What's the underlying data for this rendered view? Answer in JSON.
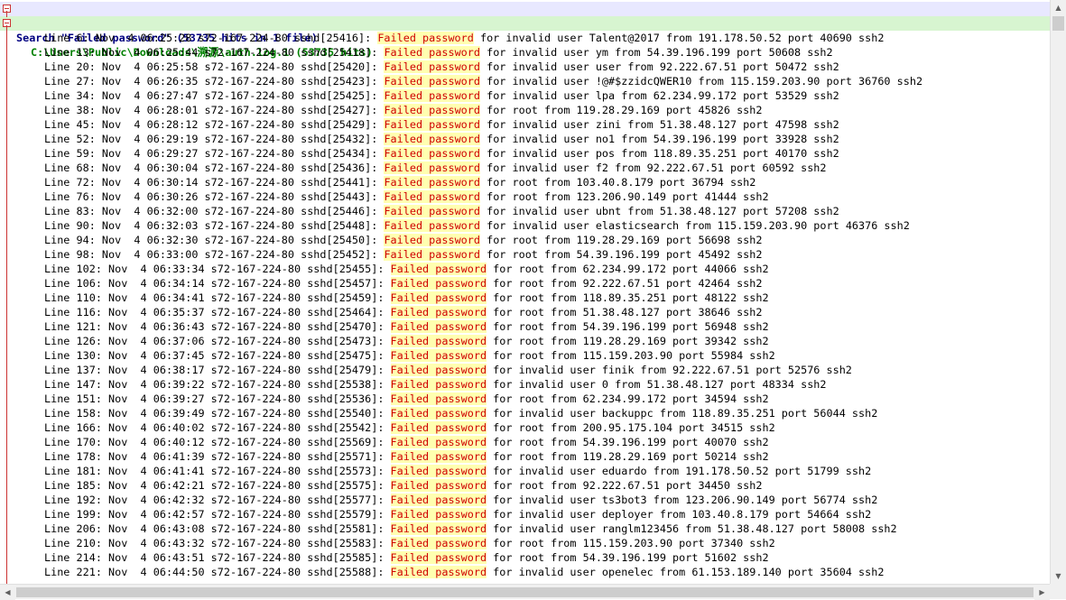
{
  "search": {
    "header": "Search \"Failed password\" (53735 hits in 1 file)",
    "file": "C:\\Users\\Public\\Downloads\\溯源\\auth.log.1 (53735 hits)"
  },
  "keyword": "Failed password",
  "rows": [
    {
      "prefix": "Line 6: Nov  4 06:25:28 s72-167-224-80 sshd[25416]: ",
      "suffix": " for invalid user Talent@2017 from 191.178.50.52 port 40690 ssh2"
    },
    {
      "prefix": "Line 13: Nov  4 06:25:44 s72-167-224-80 sshd[25418]: ",
      "suffix": " for invalid user ym from 54.39.196.199 port 50608 ssh2"
    },
    {
      "prefix": "Line 20: Nov  4 06:25:58 s72-167-224-80 sshd[25420]: ",
      "suffix": " for invalid user user from 92.222.67.51 port 50472 ssh2"
    },
    {
      "prefix": "Line 27: Nov  4 06:26:35 s72-167-224-80 sshd[25423]: ",
      "suffix": " for invalid user !@#$zzidcQWER10 from 115.159.203.90 port 36760 ssh2"
    },
    {
      "prefix": "Line 34: Nov  4 06:27:47 s72-167-224-80 sshd[25425]: ",
      "suffix": " for invalid user lpa from 62.234.99.172 port 53529 ssh2"
    },
    {
      "prefix": "Line 38: Nov  4 06:28:01 s72-167-224-80 sshd[25427]: ",
      "suffix": " for root from 119.28.29.169 port 45826 ssh2"
    },
    {
      "prefix": "Line 45: Nov  4 06:28:12 s72-167-224-80 sshd[25429]: ",
      "suffix": " for invalid user zini from 51.38.48.127 port 47598 ssh2"
    },
    {
      "prefix": "Line 52: Nov  4 06:29:19 s72-167-224-80 sshd[25432]: ",
      "suffix": " for invalid user no1 from 54.39.196.199 port 33928 ssh2"
    },
    {
      "prefix": "Line 59: Nov  4 06:29:27 s72-167-224-80 sshd[25434]: ",
      "suffix": " for invalid user pos from 118.89.35.251 port 40170 ssh2"
    },
    {
      "prefix": "Line 68: Nov  4 06:30:04 s72-167-224-80 sshd[25436]: ",
      "suffix": " for invalid user f2 from 92.222.67.51 port 60592 ssh2"
    },
    {
      "prefix": "Line 72: Nov  4 06:30:14 s72-167-224-80 sshd[25441]: ",
      "suffix": " for root from 103.40.8.179 port 36794 ssh2"
    },
    {
      "prefix": "Line 76: Nov  4 06:30:26 s72-167-224-80 sshd[25443]: ",
      "suffix": " for root from 123.206.90.149 port 41444 ssh2"
    },
    {
      "prefix": "Line 83: Nov  4 06:32:00 s72-167-224-80 sshd[25446]: ",
      "suffix": " for invalid user ubnt from 51.38.48.127 port 57208 ssh2"
    },
    {
      "prefix": "Line 90: Nov  4 06:32:03 s72-167-224-80 sshd[25448]: ",
      "suffix": " for invalid user elasticsearch from 115.159.203.90 port 46376 ssh2"
    },
    {
      "prefix": "Line 94: Nov  4 06:32:30 s72-167-224-80 sshd[25450]: ",
      "suffix": " for root from 119.28.29.169 port 56698 ssh2"
    },
    {
      "prefix": "Line 98: Nov  4 06:33:00 s72-167-224-80 sshd[25452]: ",
      "suffix": " for root from 54.39.196.199 port 45492 ssh2"
    },
    {
      "prefix": "Line 102: Nov  4 06:33:34 s72-167-224-80 sshd[25455]: ",
      "suffix": " for root from 62.234.99.172 port 44066 ssh2"
    },
    {
      "prefix": "Line 106: Nov  4 06:34:14 s72-167-224-80 sshd[25457]: ",
      "suffix": " for root from 92.222.67.51 port 42464 ssh2"
    },
    {
      "prefix": "Line 110: Nov  4 06:34:41 s72-167-224-80 sshd[25459]: ",
      "suffix": " for root from 118.89.35.251 port 48122 ssh2"
    },
    {
      "prefix": "Line 116: Nov  4 06:35:37 s72-167-224-80 sshd[25464]: ",
      "suffix": " for root from 51.38.48.127 port 38646 ssh2"
    },
    {
      "prefix": "Line 121: Nov  4 06:36:43 s72-167-224-80 sshd[25470]: ",
      "suffix": " for root from 54.39.196.199 port 56948 ssh2"
    },
    {
      "prefix": "Line 126: Nov  4 06:37:06 s72-167-224-80 sshd[25473]: ",
      "suffix": " for root from 119.28.29.169 port 39342 ssh2"
    },
    {
      "prefix": "Line 130: Nov  4 06:37:45 s72-167-224-80 sshd[25475]: ",
      "suffix": " for root from 115.159.203.90 port 55984 ssh2"
    },
    {
      "prefix": "Line 137: Nov  4 06:38:17 s72-167-224-80 sshd[25479]: ",
      "suffix": " for invalid user finik from 92.222.67.51 port 52576 ssh2"
    },
    {
      "prefix": "Line 147: Nov  4 06:39:22 s72-167-224-80 sshd[25538]: ",
      "suffix": " for invalid user 0 from 51.38.48.127 port 48334 ssh2"
    },
    {
      "prefix": "Line 151: Nov  4 06:39:27 s72-167-224-80 sshd[25536]: ",
      "suffix": " for root from 62.234.99.172 port 34594 ssh2"
    },
    {
      "prefix": "Line 158: Nov  4 06:39:49 s72-167-224-80 sshd[25540]: ",
      "suffix": " for invalid user backuppc from 118.89.35.251 port 56044 ssh2"
    },
    {
      "prefix": "Line 166: Nov  4 06:40:02 s72-167-224-80 sshd[25542]: ",
      "suffix": " for root from 200.95.175.104 port 34515 ssh2"
    },
    {
      "prefix": "Line 170: Nov  4 06:40:12 s72-167-224-80 sshd[25569]: ",
      "suffix": " for root from 54.39.196.199 port 40070 ssh2"
    },
    {
      "prefix": "Line 178: Nov  4 06:41:39 s72-167-224-80 sshd[25571]: ",
      "suffix": " for root from 119.28.29.169 port 50214 ssh2"
    },
    {
      "prefix": "Line 181: Nov  4 06:41:41 s72-167-224-80 sshd[25573]: ",
      "suffix": " for invalid user eduardo from 191.178.50.52 port 51799 ssh2"
    },
    {
      "prefix": "Line 185: Nov  4 06:42:21 s72-167-224-80 sshd[25575]: ",
      "suffix": " for root from 92.222.67.51 port 34450 ssh2"
    },
    {
      "prefix": "Line 192: Nov  4 06:42:32 s72-167-224-80 sshd[25577]: ",
      "suffix": " for invalid user ts3bot3 from 123.206.90.149 port 56774 ssh2"
    },
    {
      "prefix": "Line 199: Nov  4 06:42:57 s72-167-224-80 sshd[25579]: ",
      "suffix": " for invalid user deployer from 103.40.8.179 port 54664 ssh2"
    },
    {
      "prefix": "Line 206: Nov  4 06:43:08 s72-167-224-80 sshd[25581]: ",
      "suffix": " for invalid user ranglm123456 from 51.38.48.127 port 58008 ssh2"
    },
    {
      "prefix": "Line 210: Nov  4 06:43:32 s72-167-224-80 sshd[25583]: ",
      "suffix": " for root from 115.159.203.90 port 37340 ssh2"
    },
    {
      "prefix": "Line 214: Nov  4 06:43:51 s72-167-224-80 sshd[25585]: ",
      "suffix": " for root from 54.39.196.199 port 51602 ssh2"
    },
    {
      "prefix": "Line 221: Nov  4 06:44:50 s72-167-224-80 sshd[25588]: ",
      "suffix": " for invalid user openelec from 61.153.189.140 port 35604 ssh2"
    }
  ],
  "icons": {
    "collapse": "minus-box-icon",
    "scroll_up": "arrow-up-icon",
    "scroll_down": "arrow-down-icon",
    "scroll_left": "arrow-left-icon",
    "scroll_right": "arrow-right-icon"
  },
  "colors": {
    "keyword_text": "#d00000",
    "keyword_bg": "#ffffb0",
    "search_header_bg": "#e8e8ff",
    "file_header_bg": "#d7f5d0"
  }
}
